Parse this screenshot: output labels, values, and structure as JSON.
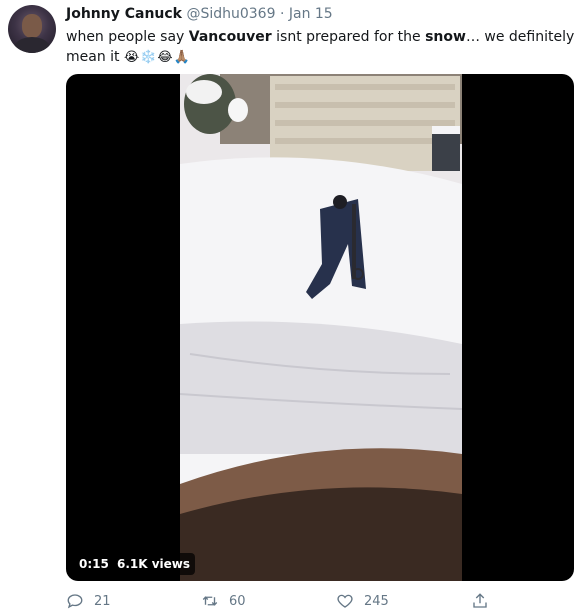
{
  "tweet": {
    "author_name": "Johnny Canuck",
    "handle": "@Sidhu0369",
    "separator": " · ",
    "date": "Jan 15",
    "text_parts": {
      "p1": "when people say ",
      "p2": "Vancouver",
      "p3": " isnt prepared for the ",
      "p4": "snow",
      "p5": "… we definitely mean it ",
      "emojis": "😭❄️😂🙏🏽"
    },
    "media": {
      "duration": "0:15",
      "views": "6.1K views"
    },
    "actions": {
      "replies": "21",
      "retweets": "60",
      "likes": "245"
    }
  },
  "icons": {
    "reply": "reply-icon",
    "retweet": "retweet-icon",
    "like": "heart-icon",
    "share": "share-icon"
  },
  "colors": {
    "name": "#14171a",
    "meta": "#657786",
    "badge_bg": "#000000"
  }
}
